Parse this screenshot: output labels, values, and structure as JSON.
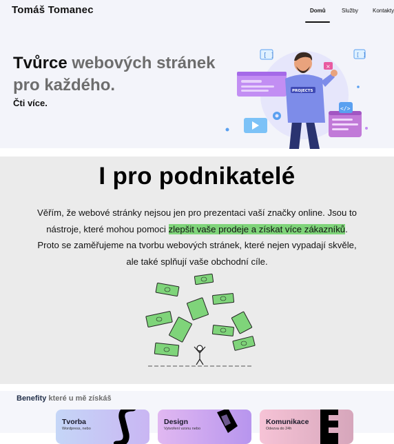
{
  "header": {
    "logo": "Tomáš Tomanec",
    "nav": [
      {
        "label": "Domů",
        "active": true
      },
      {
        "label": "Služby",
        "active": false
      },
      {
        "label": "Kontakty",
        "active": false
      }
    ]
  },
  "hero": {
    "title_dark": "Tvůrce",
    "title_grey_1": "webových stránek",
    "title_grey_2": "pro každého.",
    "cta": "Čti více.",
    "illustration_badge": "PROJECTS"
  },
  "business": {
    "title": "I pro podnikatelé",
    "text_before": "Věřím, že webové stránky nejsou jen pro prezentaci vaší značky online. Jsou to nástroje, které mohou pomoci ",
    "text_highlight": "zlepšit vaše prodeje a získat více zákazníků",
    "text_after": ". Proto se zaměřujeme na tvorbu webových stránek, které nejen vypadají skvěle, ale také splňují vaše obchodní cíle.",
    "highlight_color": "#7fd47a"
  },
  "benefits": {
    "title_bold": "Benefity",
    "title_rest": "které u mě získáš",
    "cards": [
      {
        "title": "Tvorba",
        "subtitle": "Wordpress, nebo"
      },
      {
        "title": "Design",
        "subtitle": "Vytvoření vzonu nebo"
      },
      {
        "title": "Komunikace",
        "subtitle": "Odezva do 24h"
      }
    ]
  }
}
